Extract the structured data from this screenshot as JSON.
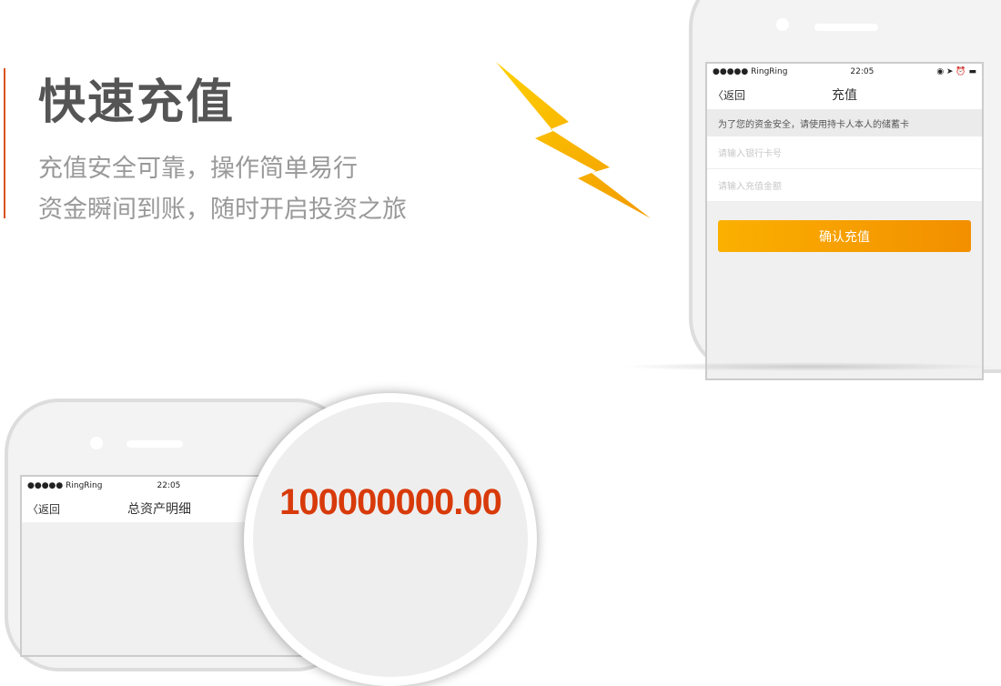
{
  "hero": {
    "title": "快速充值",
    "line1": "充值安全可靠，操作简单易行",
    "line2": "资金瞬间到账，随时开启投资之旅",
    "accent_color": "#d9531e"
  },
  "recharge_phone": {
    "status": {
      "carrier": "●●●●● RingRing",
      "wifi": "wifi-icon",
      "time": "22:05",
      "right": "◉ ➤ ⏰ ▬"
    },
    "back": "〈返回",
    "title": "充值",
    "notice": "为了您的资金安全，请使用持卡人本人的储蓄卡",
    "card_placeholder": "请输入银行卡号",
    "amount_placeholder": "请输入充值金额",
    "confirm": "确认充值"
  },
  "assets_phone": {
    "status": {
      "carrier": "●●●●● RingRing",
      "time": "22:05",
      "right": "◉ ➤"
    },
    "back": "〈返回",
    "title": "总资产明细"
  },
  "magnifier": {
    "amount": "100000000.00",
    "color": "#d83a0a"
  }
}
